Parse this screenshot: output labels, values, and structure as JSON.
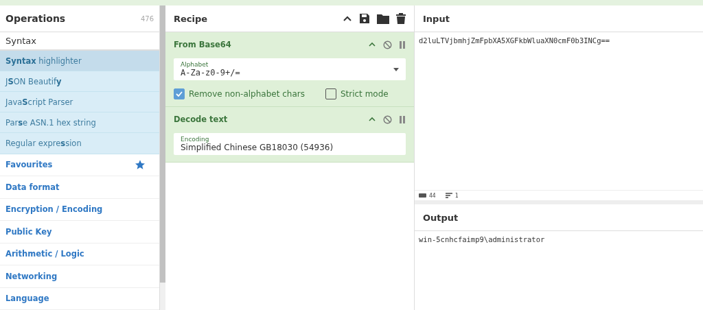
{
  "operations": {
    "title": "Operations",
    "count": "476",
    "search": {
      "value": "Syntax"
    },
    "results": [
      {
        "label": "**Syntax** highlighter",
        "selected": true
      },
      {
        "label": "J**S**ON Beautif**y**",
        "selected": false
      },
      {
        "label": "Java**S**cript Parser",
        "selected": false
      },
      {
        "label": "Par**s**e ASN.1 hex string",
        "selected": false
      },
      {
        "label": "Regular expre**s**sion",
        "selected": false
      }
    ],
    "categories": [
      {
        "label": "Favourites",
        "kind": "favourites"
      },
      {
        "label": "Data format",
        "kind": "plain"
      },
      {
        "label": "Encryption / Encoding",
        "kind": "plain"
      },
      {
        "label": "Public Key",
        "kind": "plain"
      },
      {
        "label": "Arithmetic / Logic",
        "kind": "plain"
      },
      {
        "label": "Networking",
        "kind": "plain"
      },
      {
        "label": "Language",
        "kind": "plain"
      }
    ]
  },
  "recipe": {
    "title": "Recipe",
    "steps": [
      {
        "title": "From Base64",
        "fields": [
          {
            "kind": "dropdown",
            "label": "Alphabet",
            "value": "A-Za-z0-9+/="
          }
        ],
        "options": [
          {
            "label": "Remove non-alphabet chars",
            "checked": true
          },
          {
            "label": "Strict mode",
            "checked": false
          }
        ]
      },
      {
        "title": "Decode text",
        "fields": [
          {
            "kind": "text",
            "label": "Encoding",
            "value": "Simplified Chinese GB18030 (54936)"
          }
        ]
      }
    ]
  },
  "input": {
    "title": "Input",
    "value": "d2luLTVjbmhjZmFpbXA5XGFkbWluaXN0cmF0b3INCg==",
    "status": {
      "length": "44",
      "lines": "1"
    }
  },
  "output": {
    "title": "Output",
    "value": "win-5cnhcfaimp9\\administrator"
  }
}
